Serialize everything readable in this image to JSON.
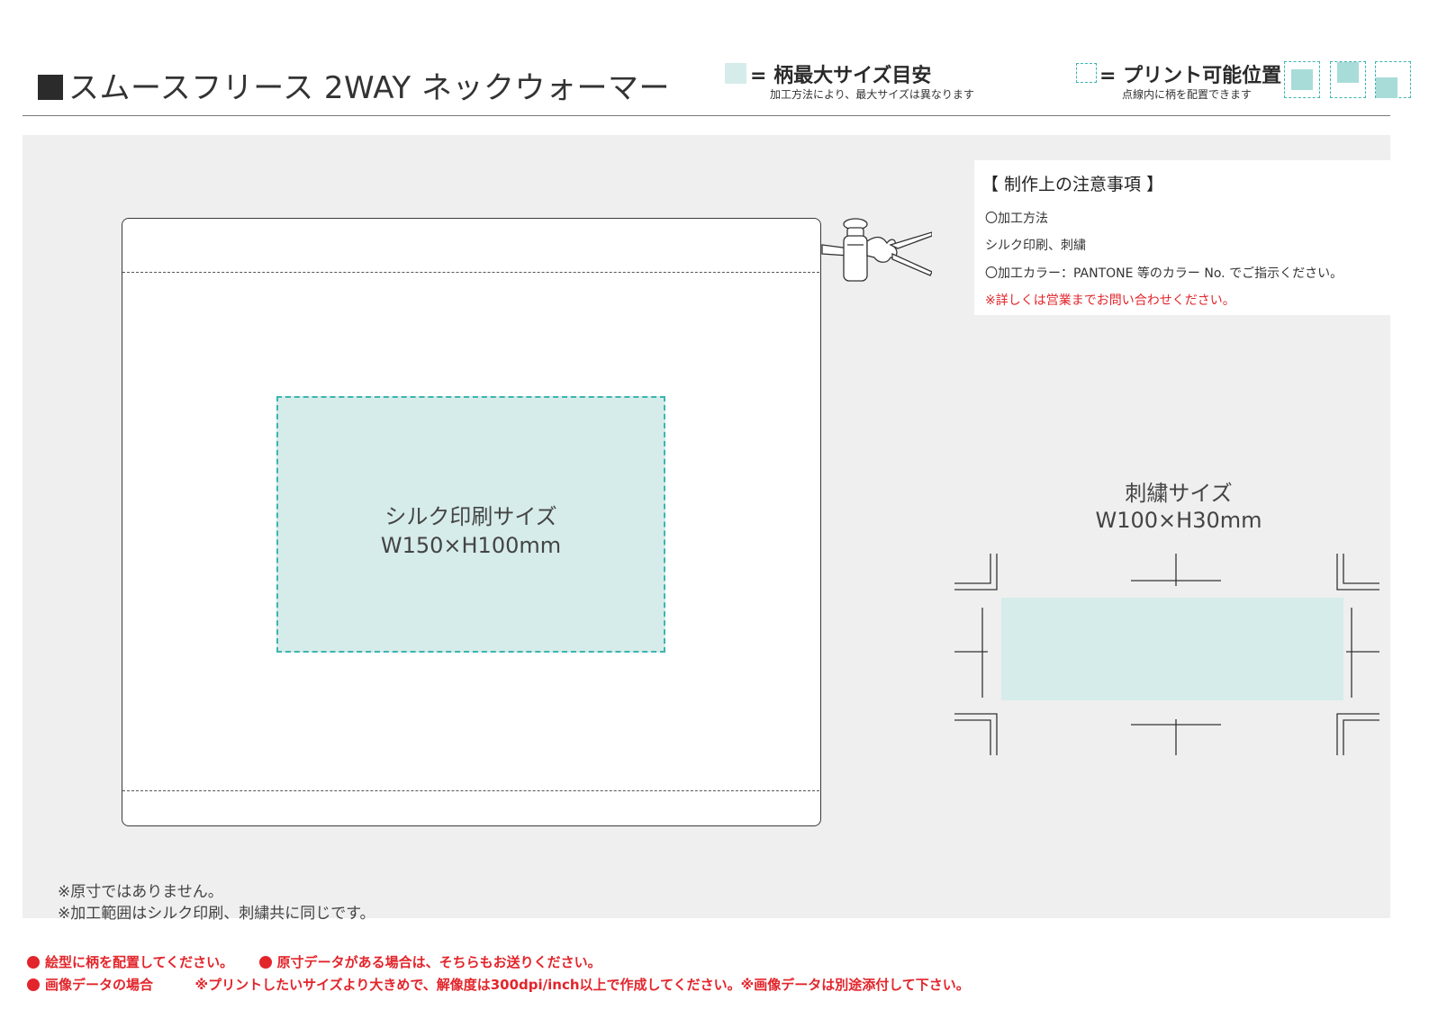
{
  "header": {
    "title": "スムースフリース 2WAY ネックウォーマー",
    "legend_max_size": {
      "label": "= 柄最大サイズ目安",
      "note": "加工方法により、最大サイズは異なります"
    },
    "legend_print_position": {
      "label": "= プリント可能位置",
      "note": "点線内に柄を配置できます"
    }
  },
  "notes": {
    "title": "【 制作上の注意事項 】",
    "lines": [
      "〇加工方法",
      "シルク印刷、刺繍",
      "〇加工カラー：PANTONE 等のカラー No. でご指示ください。",
      "※詳しくは営業までお問い合わせください。"
    ]
  },
  "silk": {
    "label": "シルク印刷サイズ",
    "size": "W150×H100mm"
  },
  "embroidery": {
    "label": "刺繍サイズ",
    "size": "W100×H30mm"
  },
  "footnotes": [
    "※原寸ではありません。",
    "※加工範囲はシルク印刷、刺繍共に同じです。"
  ],
  "bottom": {
    "item1": "絵型に柄を配置してください。",
    "item2": "原寸データがある場合は、そちらもお送りください。",
    "item3_label": "画像データの場合",
    "item3_text": "※プリントしたいサイズより大きめで、解像度は300dpi/inch以上で作成してください。※画像データは別途添付して下さい。"
  },
  "colors": {
    "print_area_fill": "#d6ecea",
    "print_area_border": "#3cb5b0",
    "notice_red": "#e2252b",
    "panel": "#eeefee"
  }
}
